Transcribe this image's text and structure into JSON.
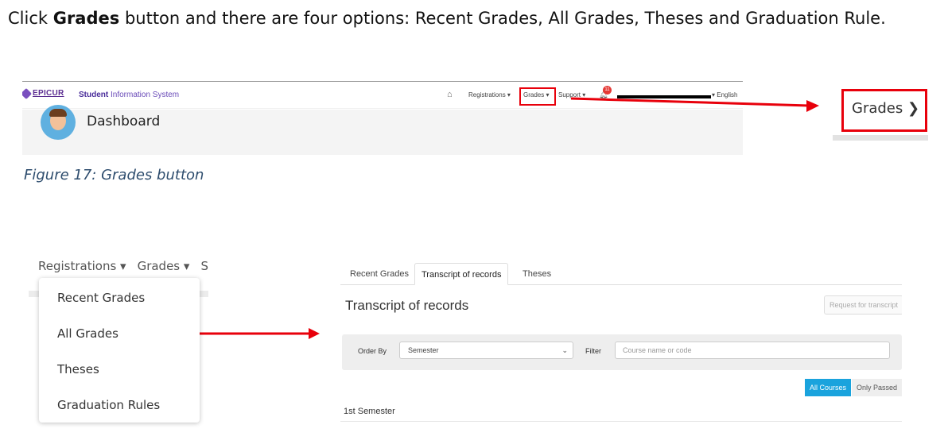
{
  "intro": {
    "part1": "Click ",
    "bold": "Grades",
    "part2": " button and there are four options: Recent Grades, All Grades, Theses and Graduation Rule."
  },
  "figure17": {
    "logo_text": "EPICUR",
    "app_name_bold": "Student",
    "app_name_rest": " Information System",
    "nav": {
      "registrations": "Registrations ▾",
      "grades": "Grades ▾",
      "support": "Support ▾",
      "badge": "11",
      "language": "▾ English"
    },
    "dashboard_title": "Dashboard",
    "zoomed_label": "Grades ❯",
    "caption": "Figure 17: Grades button"
  },
  "dropdown": {
    "nav_registrations": "Registrations ▾",
    "nav_grades": "Grades ▾",
    "nav_partial": "S",
    "items": [
      "Recent Grades",
      "All Grades",
      "Theses",
      "Graduation Rules"
    ]
  },
  "transcript": {
    "tabs": [
      "Recent Grades",
      "Transcript of records",
      "Theses"
    ],
    "active_tab": "Transcript of records",
    "title": "Transcript of records",
    "request_button": "Request for transcript",
    "order_by_label": "Order By",
    "order_by_value": "Semester",
    "filter_label": "Filter",
    "filter_placeholder": "Course name or code",
    "all_courses": "All Courses",
    "only_passed": "Only Passed",
    "semester_heading": "1st Semester"
  },
  "colors": {
    "highlight_red": "#e8000b",
    "primary_blue": "#1aa3dd",
    "brand_purple": "#5b2d91"
  }
}
